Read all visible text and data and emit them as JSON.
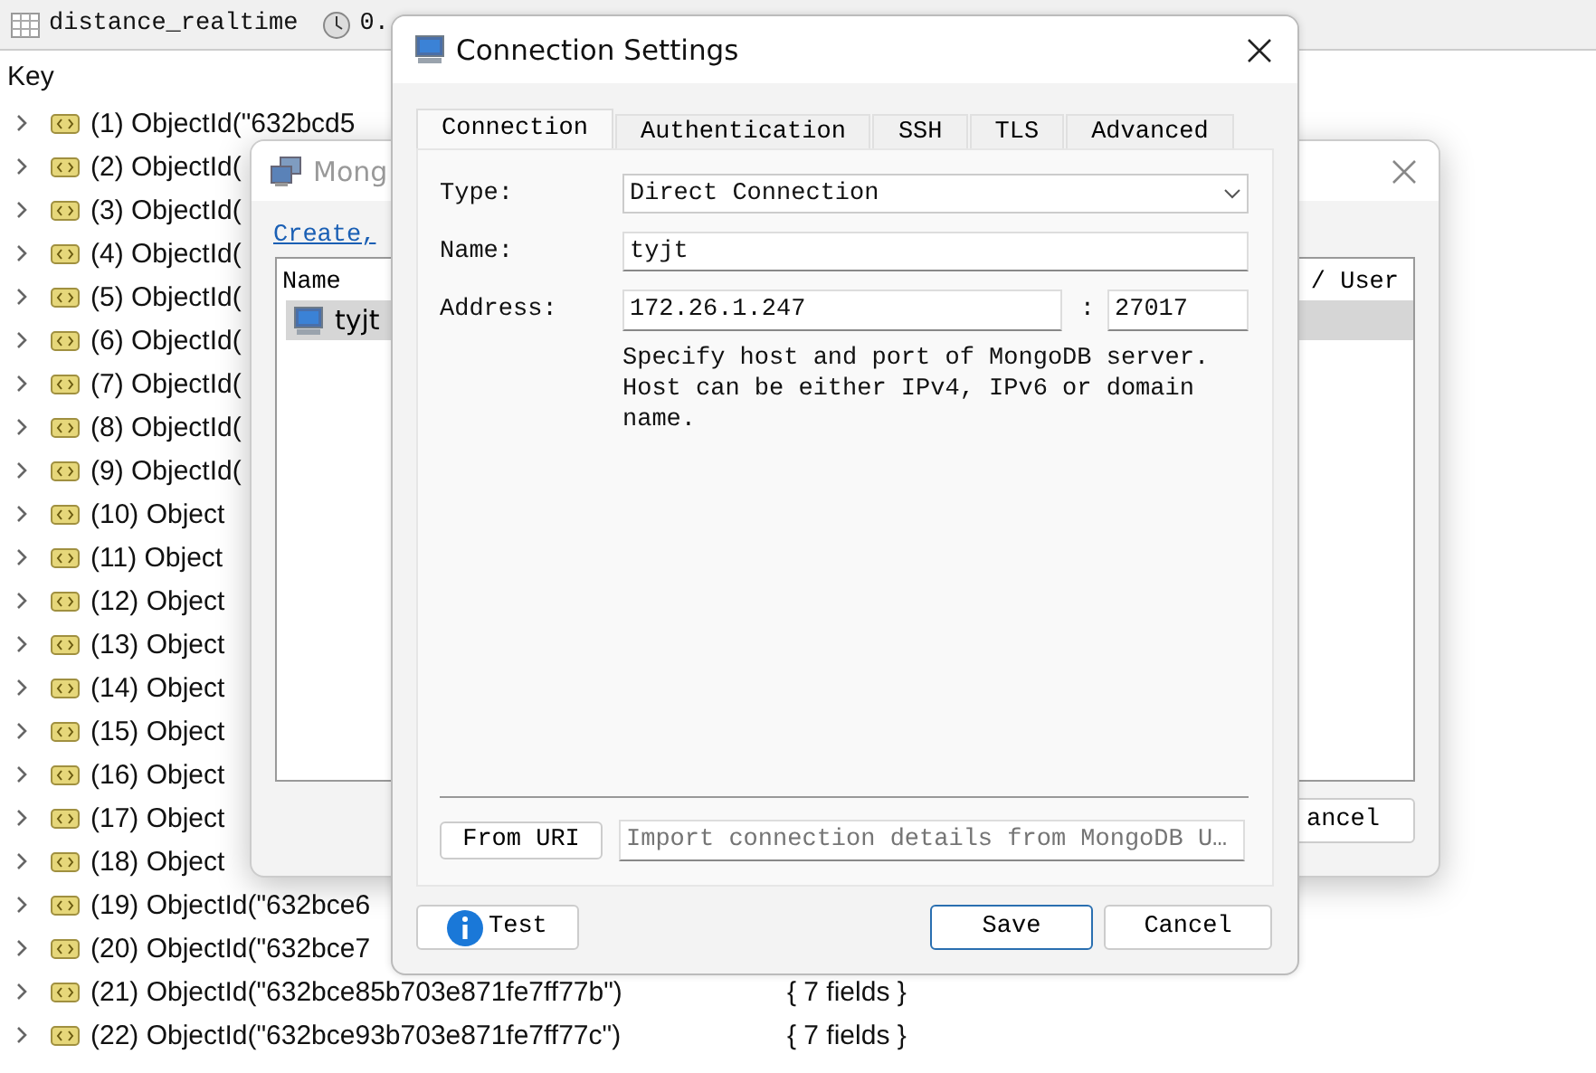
{
  "toolbar": {
    "collection": "distance_realtime",
    "time": "0."
  },
  "table": {
    "columns": [
      {
        "label": "Key"
      }
    ],
    "rows": [
      {
        "key": "(1) ObjectId(\"632bcd5",
        "expanded": false
      },
      {
        "key": "(2) ObjectId(",
        "expanded": false
      },
      {
        "key": "(3) ObjectId(",
        "expanded": false
      },
      {
        "key": "(4) ObjectId(",
        "expanded": false
      },
      {
        "key": "(5) ObjectId(",
        "expanded": false
      },
      {
        "key": "(6) ObjectId(",
        "expanded": false
      },
      {
        "key": "(7) ObjectId(",
        "expanded": false
      },
      {
        "key": "(8) ObjectId(",
        "expanded": false
      },
      {
        "key": "(9) ObjectId(",
        "expanded": false
      },
      {
        "key": "(10) Object",
        "expanded": false
      },
      {
        "key": "(11) Object",
        "expanded": false
      },
      {
        "key": "(12) Object",
        "expanded": false
      },
      {
        "key": "(13) Object",
        "expanded": false
      },
      {
        "key": "(14) Object",
        "expanded": false
      },
      {
        "key": "(15) Object",
        "expanded": false
      },
      {
        "key": "(16) Object",
        "expanded": false
      },
      {
        "key": "(17) Object",
        "expanded": false
      },
      {
        "key": "(18) Object",
        "expanded": false
      },
      {
        "key": "(19) ObjectId(\"632bce6",
        "expanded": false
      },
      {
        "key": "(20) ObjectId(\"632bce7",
        "expanded": false
      },
      {
        "key": "(21) ObjectId(\"632bce85b703e871fe7ff77b\")",
        "value": "{ 7 fields }",
        "expanded": false
      },
      {
        "key": "(22) ObjectId(\"632bce93b703e871fe7ff77c\")",
        "value": "{ 7 fields }",
        "expanded": false
      }
    ]
  },
  "connections_dialog": {
    "title": "Mong",
    "link": "Create,",
    "columns": [
      "Name",
      "/ User"
    ],
    "rows": [
      {
        "name": "tyjt",
        "selected": true
      }
    ],
    "button": "ancel"
  },
  "settings_dialog": {
    "title": "Connection Settings",
    "tabs": [
      {
        "label": "Connection",
        "selected": true
      },
      {
        "label": "Authentication",
        "selected": false
      },
      {
        "label": "SSH",
        "selected": false
      },
      {
        "label": "TLS",
        "selected": false
      },
      {
        "label": "Advanced",
        "selected": false
      }
    ],
    "type": {
      "label": "Type:",
      "value": "Direct Connection"
    },
    "name": {
      "label": "Name:",
      "value": "tyjt"
    },
    "address": {
      "label": "Address:",
      "host": "172.26.1.247",
      "separator": ":",
      "port": "27017"
    },
    "help": "Specify host and port of MongoDB server. Host can be either IPv4, IPv6 or domain name.",
    "from_uri": "From URI",
    "uri": {
      "placeholder": "Import connection details from MongoDB U…"
    },
    "buttons": [
      {
        "label": "Test",
        "kind": "info"
      },
      {
        "label": "Save",
        "kind": "default"
      },
      {
        "label": "Cancel",
        "kind": "plain"
      }
    ]
  }
}
